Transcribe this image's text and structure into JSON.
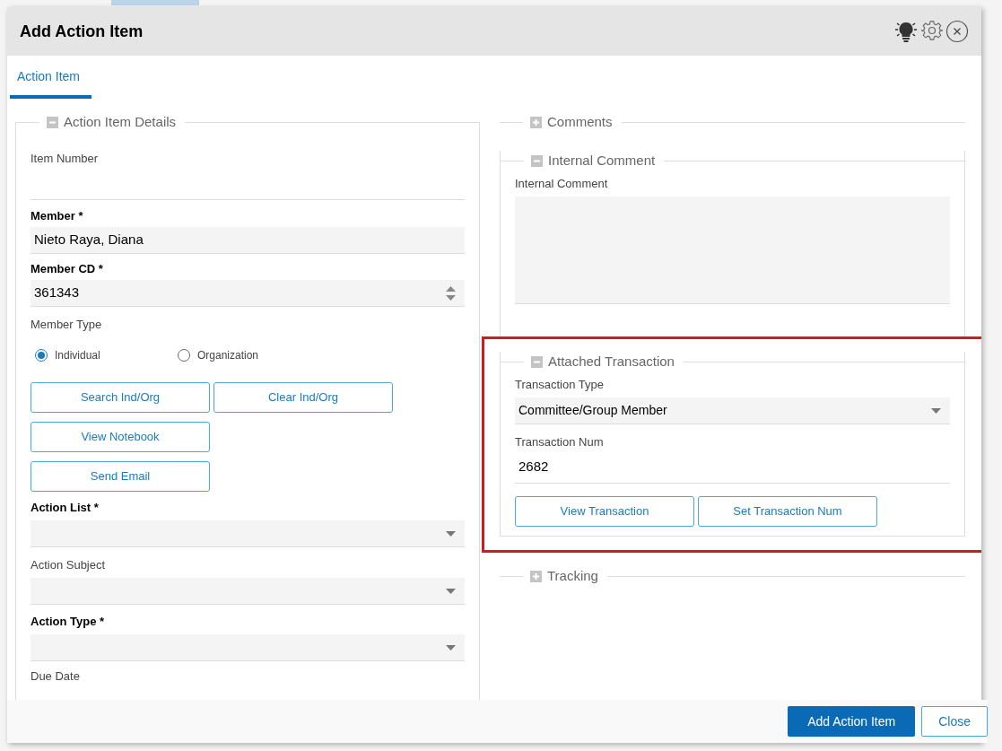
{
  "window": {
    "title": "Add Action Item"
  },
  "tabs": [
    {
      "label": "Action Item",
      "selected": true
    }
  ],
  "left_section": {
    "title": "Action Item Details",
    "expanded": true,
    "fields": [
      {
        "kind": "text",
        "label": "Item Number",
        "required": false
      },
      {
        "kind": "filled",
        "label": "Member *",
        "required": true,
        "value": "Nieto Raya, Diana"
      },
      {
        "kind": "number",
        "label": "Member CD *",
        "required": true,
        "value": "361343"
      },
      {
        "kind": "radio",
        "label": "Member Type",
        "required": false,
        "options": [
          {
            "label": "Individual",
            "selected": true
          },
          {
            "label": "Organization",
            "selected": false
          }
        ]
      },
      {
        "kind": "buttons",
        "rows": [
          [
            "Search Ind/Org",
            "Clear Ind/Org"
          ],
          [
            "View Notebook"
          ],
          [
            "Send Email"
          ]
        ]
      },
      {
        "kind": "select",
        "label": "Action List *",
        "required": true
      },
      {
        "kind": "select",
        "label": "Action Subject",
        "required": false
      },
      {
        "kind": "select",
        "label": "Action Type *",
        "required": true
      },
      {
        "kind": "label",
        "label": "Due Date",
        "required": false
      }
    ]
  },
  "right_sections": [
    {
      "title": "Comments",
      "expanded": false
    },
    {
      "title": "Internal Comment",
      "expanded": true,
      "fields": [
        {
          "kind": "textarea",
          "label": "Internal Comment"
        }
      ]
    },
    {
      "title": "Attached Transaction",
      "expanded": true,
      "highlighted": true,
      "fields": [
        {
          "kind": "select",
          "label": "Transaction Type",
          "value": "Committee/Group Member"
        },
        {
          "kind": "text",
          "label": "Transaction Num",
          "value": "2682"
        },
        {
          "kind": "buttons",
          "rows": [
            [
              "View Transaction",
              "Set Transaction Num"
            ]
          ]
        }
      ]
    },
    {
      "title": "Tracking",
      "expanded": false
    }
  ],
  "footer": {
    "buttons": [
      {
        "label": "Add Action Item",
        "primary": true
      },
      {
        "label": "Close",
        "primary": false
      }
    ]
  }
}
